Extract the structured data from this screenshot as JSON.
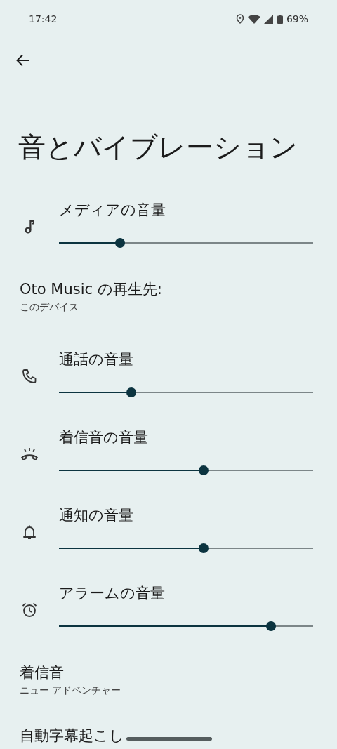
{
  "status_bar": {
    "time": "17:42",
    "battery": "69%"
  },
  "title": "音とバイブレーション",
  "items": [
    {
      "kind": "media",
      "label": "メディアの音量",
      "level": 0.24
    },
    {
      "kind": "info",
      "title": "Oto Music の再生先:",
      "subtitle": "このデバイス"
    },
    {
      "kind": "call",
      "label": "通話の音量",
      "level": 0.285
    },
    {
      "kind": "ring",
      "label": "着信音の音量",
      "level": 0.57
    },
    {
      "kind": "notification",
      "label": "通知の音量",
      "level": 0.57
    },
    {
      "kind": "alarm",
      "label": "アラームの音量",
      "level": 0.835
    },
    {
      "kind": "info",
      "title": "着信音",
      "subtitle": "ニュー アドベンチャー"
    },
    {
      "kind": "info",
      "title": "自動字幕起こし"
    }
  ]
}
